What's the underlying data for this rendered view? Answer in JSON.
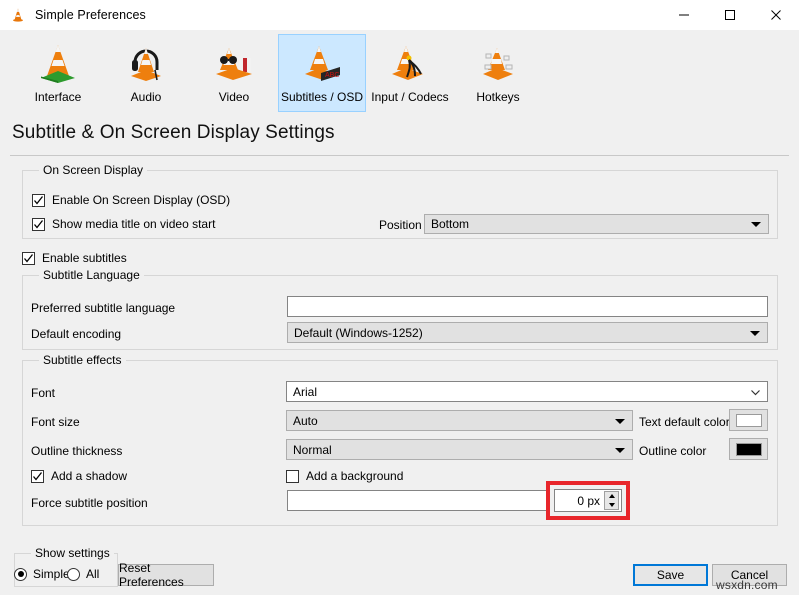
{
  "window": {
    "title": "Simple Preferences",
    "icon": "vlc-cone-icon",
    "controls": {
      "minimize": "minimize-icon",
      "maximize": "maximize-icon",
      "close": "close-icon"
    }
  },
  "toolbar": {
    "items": [
      {
        "label": "Interface",
        "icon": "vlc-interface-icon",
        "selected": false
      },
      {
        "label": "Audio",
        "icon": "vlc-audio-icon",
        "selected": false
      },
      {
        "label": "Video",
        "icon": "vlc-video-icon",
        "selected": false
      },
      {
        "label": "Subtitles / OSD",
        "icon": "vlc-subtitles-icon",
        "selected": true
      },
      {
        "label": "Input / Codecs",
        "icon": "vlc-input-codecs-icon",
        "selected": false
      },
      {
        "label": "Hotkeys",
        "icon": "vlc-hotkeys-icon",
        "selected": false
      }
    ]
  },
  "page": {
    "title": "Subtitle & On Screen Display Settings"
  },
  "osd": {
    "group_title": "On Screen Display",
    "enable_osd": {
      "label": "Enable On Screen Display (OSD)",
      "checked": true
    },
    "show_media_title": {
      "label": "Show media title on video start",
      "checked": true
    },
    "position": {
      "label": "Position",
      "value": "Bottom"
    }
  },
  "enable_subtitles": {
    "label": "Enable subtitles",
    "checked": true
  },
  "subtitle_language": {
    "group_title": "Subtitle Language",
    "preferred": {
      "label": "Preferred subtitle language",
      "value": "",
      "placeholder": ""
    },
    "encoding": {
      "label": "Default encoding",
      "value": "Default (Windows-1252)"
    }
  },
  "subtitle_effects": {
    "group_title": "Subtitle effects",
    "font": {
      "label": "Font",
      "value": "Arial"
    },
    "font_size": {
      "label": "Font size",
      "value": "Auto"
    },
    "outline_thickness": {
      "label": "Outline thickness",
      "value": "Normal"
    },
    "add_shadow": {
      "label": "Add a shadow",
      "checked": true
    },
    "add_background": {
      "label": "Add a background",
      "checked": false
    },
    "force_position": {
      "label": "Force subtitle position",
      "value": "",
      "spin_value": "0 px"
    },
    "text_default_color": {
      "label": "Text default color",
      "color": "#ffffff"
    },
    "outline_color": {
      "label": "Outline color",
      "color": "#000000"
    }
  },
  "footer": {
    "show_settings": {
      "group_title": "Show settings",
      "options": [
        {
          "label": "Simple",
          "selected": true
        },
        {
          "label": "All",
          "selected": false
        }
      ]
    },
    "reset": "Reset Preferences",
    "save": "Save",
    "cancel": "Cancel"
  },
  "watermark": "wsxdn.com",
  "colors": {
    "accent": "#0078d7",
    "selection": "#cce8ff",
    "highlight": "#e8262b"
  }
}
